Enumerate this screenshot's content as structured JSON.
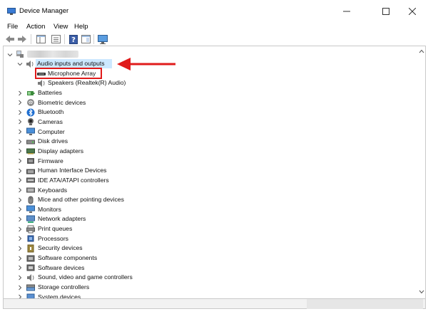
{
  "window": {
    "title": "Device Manager",
    "min_icon": "minimize-icon",
    "max_icon": "maximize-icon",
    "close_icon": "close-icon"
  },
  "menu": [
    "File",
    "Action",
    "View",
    "Help"
  ],
  "toolbar": [
    "back-icon",
    "forward-icon",
    "show-hide-tree-icon",
    "properties-icon",
    "help-icon",
    "action-pane-icon",
    "monitor-icon"
  ],
  "tree": {
    "root_label": "",
    "expanded_category": "Audio inputs and outputs",
    "expanded_children": [
      "Microphone Array",
      "Speakers (Realtek(R) Audio)"
    ],
    "categories": [
      "Batteries",
      "Biometric devices",
      "Bluetooth",
      "Cameras",
      "Computer",
      "Disk drives",
      "Display adapters",
      "Firmware",
      "Human Interface Devices",
      "IDE ATA/ATAPI controllers",
      "Keyboards",
      "Mice and other pointing devices",
      "Monitors",
      "Network adapters",
      "Print queues",
      "Processors",
      "Security devices",
      "Software components",
      "Software devices",
      "Sound, video and game controllers",
      "Storage controllers",
      "System devices"
    ]
  },
  "colors": {
    "highlight_border": "#e01b1b",
    "arrow": "#e01b1b",
    "selection": "#cce8ff"
  }
}
